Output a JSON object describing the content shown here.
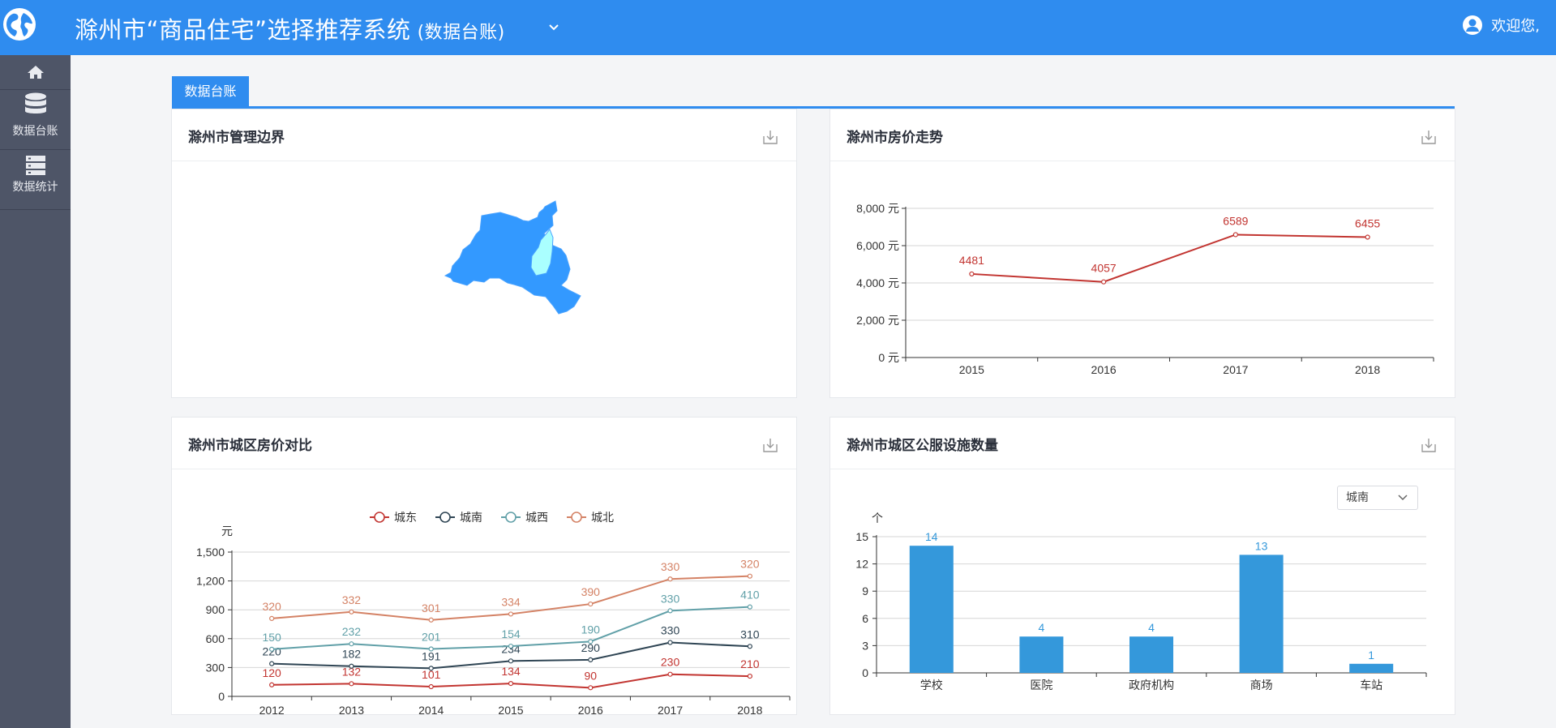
{
  "header": {
    "title": "滁州市“商品住宅”选择推荐系统",
    "subtitle": "(数据台账)",
    "welcome": "欢迎您,"
  },
  "sidebar": {
    "items": [
      {
        "label": "",
        "icon": "home-icon"
      },
      {
        "label": "数据台账",
        "icon": "database-icon"
      },
      {
        "label": "数据统计",
        "icon": "server-icon"
      }
    ]
  },
  "tab": {
    "label": "数据台账"
  },
  "colors": {
    "primary": "#2f8cef",
    "sidebar": "#4e5567",
    "map_fill": "#3399ff",
    "map_highlight": "#aaffff",
    "bar": "#3498db",
    "price_line": "#c23531"
  },
  "panels": {
    "boundary": {
      "title": "滁州市管理边界"
    },
    "trend": {
      "title": "滁州市房价走势"
    },
    "district": {
      "title": "滁州市城区房价对比"
    },
    "facilities": {
      "title": "滁州市城区公服设施数量",
      "select_value": "城南"
    }
  },
  "chart_data": [
    {
      "type": "line",
      "categories": [
        "2015",
        "2016",
        "2017",
        "2018"
      ],
      "series": [
        {
          "values": [
            4481,
            4057,
            6589,
            6455
          ]
        }
      ],
      "ylim": [
        0,
        8000
      ],
      "yticks": [
        "0 元",
        "2,000 元",
        "4,000 元",
        "6,000 元",
        "8,000 元"
      ]
    },
    {
      "type": "line",
      "categories": [
        "2012",
        "2013",
        "2014",
        "2015",
        "2016",
        "2017",
        "2018"
      ],
      "ylabel": "元",
      "ylim": [
        0,
        1500
      ],
      "yticks": [
        "0",
        "300",
        "600",
        "900",
        "1,200",
        "1,500"
      ],
      "stacked": true,
      "legend_position": "top",
      "series": [
        {
          "name": "城东",
          "color": "#c23531",
          "values": [
            120,
            132,
            101,
            134,
            90,
            230,
            210
          ]
        },
        {
          "name": "城南",
          "color": "#2f4554",
          "values": [
            220,
            182,
            191,
            234,
            290,
            330,
            310
          ]
        },
        {
          "name": "城西",
          "color": "#61a0a8",
          "values": [
            150,
            232,
            201,
            154,
            190,
            330,
            410
          ]
        },
        {
          "name": "城北",
          "color": "#d48265",
          "values": [
            320,
            332,
            301,
            334,
            390,
            330,
            320
          ]
        }
      ]
    },
    {
      "type": "bar",
      "categories": [
        "学校",
        "医院",
        "政府机构",
        "商场",
        "车站"
      ],
      "values": [
        14,
        4,
        4,
        13,
        1
      ],
      "ylabel": "个",
      "ylim": [
        0,
        15
      ],
      "yticks": [
        "0",
        "3",
        "6",
        "9",
        "12",
        "15"
      ]
    }
  ]
}
